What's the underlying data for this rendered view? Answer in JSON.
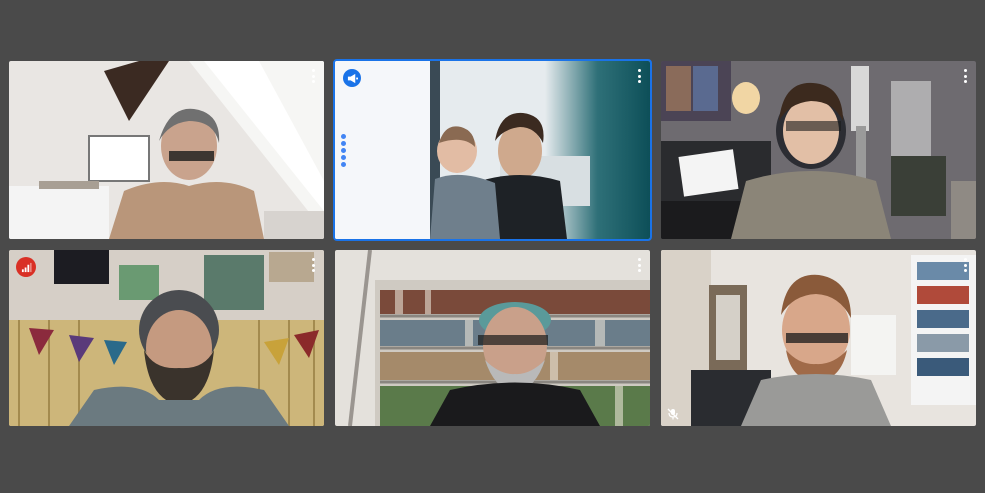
{
  "meeting": {
    "participants": [
      {
        "id": "p1",
        "role": "video-tile",
        "state": "normal",
        "menu_icon": "more-vert-icon"
      },
      {
        "id": "p2",
        "role": "video-tile",
        "state": "active-speaker",
        "indicator_icon": "megaphone-icon",
        "menu_icon": "more-vert-icon"
      },
      {
        "id": "p3",
        "role": "video-tile",
        "state": "normal",
        "menu_icon": "more-vert-icon"
      },
      {
        "id": "p4",
        "role": "video-tile",
        "state": "poor-connection",
        "indicator_icon": "signal-bars-icon",
        "menu_icon": "more-vert-icon"
      },
      {
        "id": "p5",
        "role": "video-tile",
        "state": "normal",
        "menu_icon": "more-vert-icon"
      },
      {
        "id": "p6",
        "role": "video-tile",
        "state": "muted",
        "indicator_icon": "mic-off-icon",
        "menu_icon": "more-vert-icon"
      }
    ]
  },
  "colors": {
    "background": "#4a4a4a",
    "active_outline": "#1a73e8",
    "connection_badge": "#d93025",
    "speaking_badge": "#1a73e8"
  }
}
